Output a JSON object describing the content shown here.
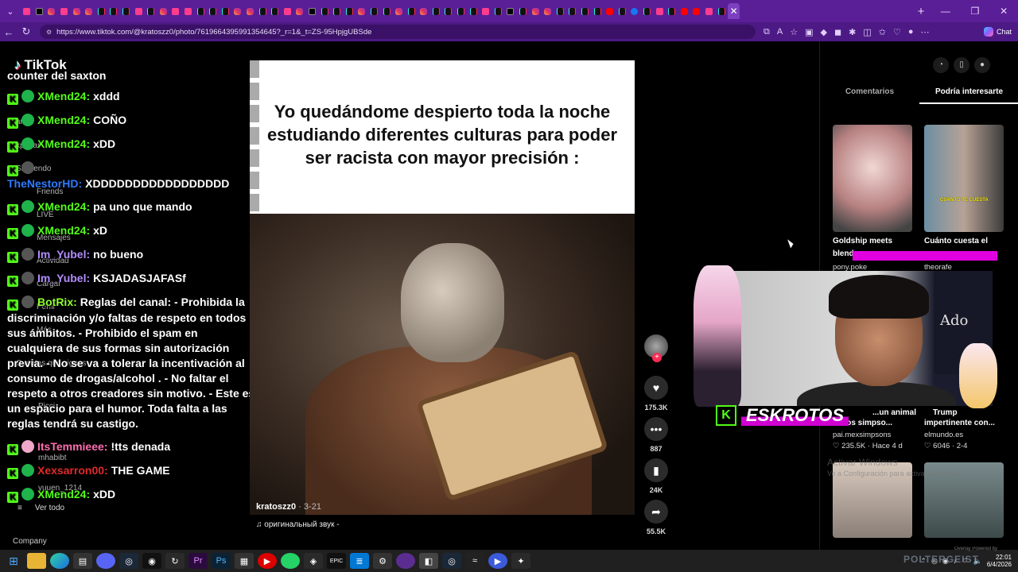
{
  "browser": {
    "url": "https://www.tiktok.com/@kratoszz0/photo/7619664395991354645?_r=1&_t=ZS-95HpjgUBSde",
    "chat_label": "Chat",
    "tab_favicons": [
      "pk",
      "x",
      "ig",
      "pk",
      "ig",
      "ig",
      "tt",
      "tt",
      "tt",
      "pk",
      "tt",
      "ig",
      "pk",
      "pk",
      "tt",
      "tt",
      "tt",
      "ig",
      "ig",
      "tt",
      "tt",
      "pk",
      "ig",
      "x",
      "tt",
      "tt",
      "tt",
      "ig",
      "tt",
      "tt",
      "ig",
      "tt",
      "ig",
      "tt",
      "tt",
      "tt",
      "tt",
      "pk",
      "tt",
      "x",
      "tt",
      "ig",
      "ig",
      "tt",
      "tt",
      "tt",
      "tt",
      "yt",
      "tt",
      "fb",
      "tt",
      "pk",
      "tt",
      "yt",
      "yt",
      "pk",
      "tt"
    ]
  },
  "tiktok": {
    "logo": "TikTok",
    "sidebar_ghost": [
      "ara ti",
      "xplorar",
      "Siguiendo",
      "Friends",
      "LIVE",
      "Mensajes",
      "Actividad",
      "Cargar",
      "Perfil",
      "Más",
      "Cuentas que sigues",
      "Picci",
      "mhabibt",
      "yuuen_1214"
    ],
    "see_all": "Ver todo",
    "company": "Company"
  },
  "chat": {
    "first_line": "counter del saxton",
    "messages": [
      {
        "user": "XMend24:",
        "text": "xddd",
        "color": "green",
        "badge": "green"
      },
      {
        "user": "XMend24:",
        "text": "COÑO",
        "color": "green",
        "badge": "green"
      },
      {
        "user": "XMend24:",
        "text": "xDD",
        "color": "green",
        "badge": "green"
      },
      {
        "user": "TheNestorHD:",
        "text": "XDDDDDDDDDDDDDDDDD",
        "color": "blue",
        "badge": "bot"
      },
      {
        "user": "XMend24:",
        "text": "pa uno que mando",
        "color": "green",
        "badge": "green"
      },
      {
        "user": "XMend24:",
        "text": "xD",
        "color": "green",
        "badge": "green"
      },
      {
        "user": "Im_Yubel:",
        "text": "no bueno",
        "color": "violet",
        "badge": "bot"
      },
      {
        "user": "Im_Yubel:",
        "text": "KSJADASJAFASf",
        "color": "violet",
        "badge": "bot"
      },
      {
        "user": "BotRix:",
        "text": "Reglas del canal: - Prohibida la discriminación y/o faltas de respeto en todos sus ámbitos. - Prohibido el spam en cualquiera de sus formas sin autorización previa. - No se va a tolerar la incentivación al consumo de drogas/alcohol . - No faltar el respeto a otros creadores sin motivo. - Este es un espacio para el humor. Toda falta a las reglas tendrá su castigo.",
        "color": "lime",
        "badge": "bot"
      },
      {
        "user": "ItsTemmieee:",
        "text": "!tts denada",
        "color": "pink",
        "badge": "pink"
      },
      {
        "user": "Xexsarron00:",
        "text": "THE GAME",
        "color": "red",
        "badge": "green"
      },
      {
        "user": "XMend24:",
        "text": "xDD",
        "color": "green",
        "badge": "green"
      }
    ]
  },
  "video": {
    "meme_text": "Yo quedándome despierto toda la noche estudiando diferentes culturas para poder ser racista con mayor precisión :",
    "author": "kratoszz0",
    "date": "· 3-21",
    "sound": "♫  оригинальный звук -"
  },
  "actions": {
    "likes": "175.3K",
    "comments": "887",
    "saves": "24K",
    "shares": "55.5K"
  },
  "right_panel": {
    "tab_comments": "Comentarios",
    "tab_interest": "Podría interesarte",
    "card1_title": "Goldship meets",
    "card1_title2": "blend",
    "card1_author": "pony.poke",
    "card2_title": "Cuánto cuesta el",
    "card2_caption": "CUANTO TE CUESTA",
    "card2_author": "theorafe",
    "card3_title": "...un animal",
    "card3_title2": "de los simpso...",
    "card3_author": "pai.mexsimpsons",
    "card3_meta": "♡ 235.5K · Hace 4 d",
    "card4_title": "Trump",
    "card4_title2": "impertinente con...",
    "card4_author": "elmundo.es",
    "card4_meta": "♡ 6046 · 2-4",
    "activate": "Activar Windows",
    "activate2": "Ve a Configuración para activar Windows."
  },
  "stream": {
    "streamer_name": "ESKROTOS",
    "poster_text": "Ado",
    "watermark": "POLTERGEIST",
    "overlay_by": "Overlay Powered by"
  },
  "taskbar": {
    "time": "22:01",
    "date": "6/4/2026"
  }
}
